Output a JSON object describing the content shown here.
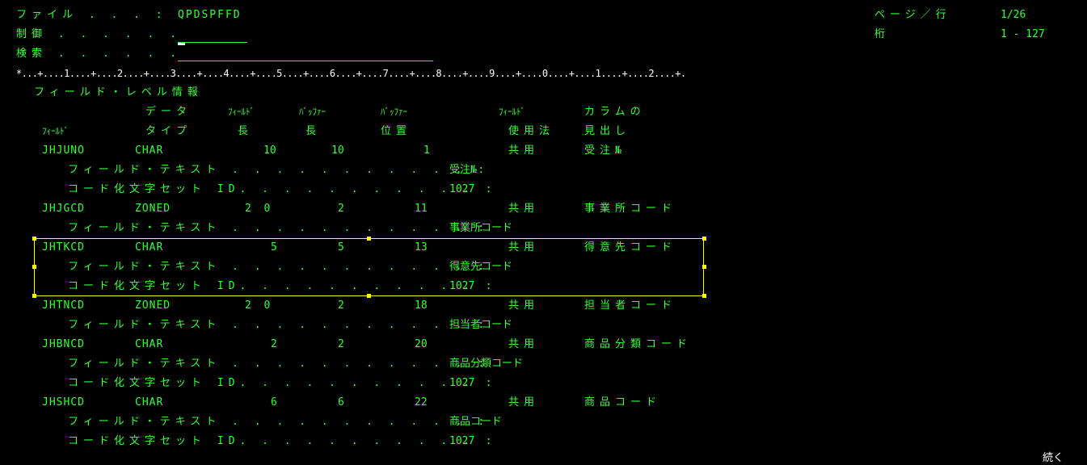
{
  "header": {
    "file_label": "ファイル . . . :",
    "file_value": "QPDSPFFD",
    "control_label": "制御 . . . . . .",
    "control_value": "",
    "search_label": "検索 . . . . . .",
    "search_value": "",
    "page_row_label": "ページ／行",
    "page_row_value": "1/26",
    "columns_label": "桁",
    "columns_value": "1 - 127"
  },
  "ruler": "*...+....1....+....2....+....3....+....4....+....5....+....6....+....7....+....8....+....9....+....0....+....1....+....2....+.",
  "section_title": "フィールド・レベル情報",
  "column_headers": {
    "row1": {
      "data": "データ",
      "field_len": "ﾌｨｰﾙﾄﾞ",
      "buffer_len": "ﾊﾞｯﾌｧｰ",
      "buffer_pos": "ﾊﾞｯﾌｧｰ",
      "field_usage": "ﾌｨｰﾙﾄﾞ",
      "column": "カラムの"
    },
    "row2": {
      "field": "ﾌｨｰﾙﾄﾞ",
      "type": "タイプ",
      "len": "長",
      "buf_len": "長",
      "pos": "位置",
      "usage": "使用法",
      "heading": "見出し"
    }
  },
  "fields": [
    {
      "name": "JHJUNO",
      "type": "CHAR",
      "length": "10",
      "buffer_length": "10",
      "position": "1",
      "usage": "共用",
      "heading": "受注№",
      "details": [
        {
          "label": "フィールド・テキスト . . . . . . . . . . . :",
          "value": "受注№"
        },
        {
          "label": "コード化文字セット ID. . . . . . . . . . . :",
          "value": "1027"
        }
      ]
    },
    {
      "name": "JHJGCD",
      "type": "ZONED",
      "length": "2  0",
      "buffer_length": "2",
      "position": "11",
      "usage": "共用",
      "heading": "事業所コード",
      "details": [
        {
          "label": "フィールド・テキスト . . . . . . . . . . . :",
          "value": "事業所コード"
        }
      ]
    },
    {
      "name": "JHTKCD",
      "type": "CHAR",
      "length": "5",
      "buffer_length": "5",
      "position": "13",
      "usage": "共用",
      "heading": "得意先コード",
      "details": [
        {
          "label": "フィールド・テキスト . . . . . . . . . . . :",
          "value": "得意先コード"
        },
        {
          "label": "コード化文字セット ID. . . . . . . . . . . :",
          "value": "1027"
        }
      ]
    },
    {
      "name": "JHTNCD",
      "type": "ZONED",
      "length": "2  0",
      "buffer_length": "2",
      "position": "18",
      "usage": "共用",
      "heading": "担当者コード",
      "details": [
        {
          "label": "フィールド・テキスト . . . . . . . . . . . :",
          "value": "担当者コード"
        }
      ]
    },
    {
      "name": "JHBNCD",
      "type": "CHAR",
      "length": "2",
      "buffer_length": "2",
      "position": "20",
      "usage": "共用",
      "heading": "商品分類コード",
      "details": [
        {
          "label": "フィールド・テキスト . . . . . . . . . . . :",
          "value": "商品分類コード"
        },
        {
          "label": "コード化文字セット ID. . . . . . . . . . . :",
          "value": "1027"
        }
      ]
    },
    {
      "name": "JHSHCD",
      "type": "CHAR",
      "length": "6",
      "buffer_length": "6",
      "position": "22",
      "usage": "共用",
      "heading": "商品コード",
      "details": [
        {
          "label": "フィールド・テキスト . . . . . . . . . . . :",
          "value": "商品コード"
        },
        {
          "label": "コード化文字セット ID. . . . . . . . . . . :",
          "value": "1027"
        }
      ]
    }
  ],
  "footer": {
    "more": "続く"
  }
}
